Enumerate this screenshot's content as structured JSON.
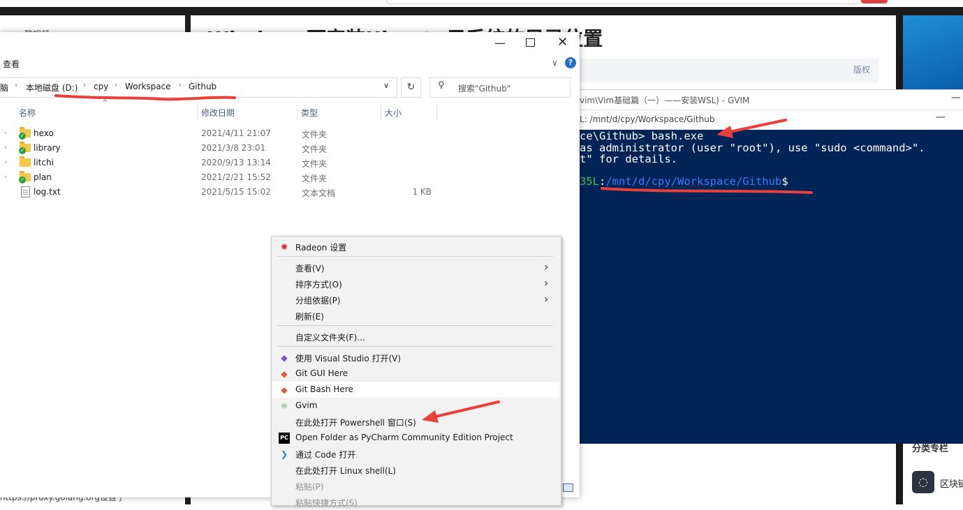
{
  "background_page": {
    "article_title": "Windows下安装Ubuntu子系统的目录位置",
    "copyright": "版权",
    "left_sidebar_text": "酷视频",
    "left_char": "疗",
    "bottom_left_text": "nttps://proxy.golang.org设置了",
    "right_panel": {
      "category": "分类专栏",
      "block_label": "区块链"
    }
  },
  "gvim": {
    "title": "vim\\Vim基础篇（一）——安装WSL) - GVIM",
    "minimize": "—"
  },
  "terminal": {
    "title": "L: /mnt/d/cpy/Workspace/Github",
    "minimize": "—",
    "line1_prefix": "ce\\Github> ",
    "line1_cmd": "bash.exe",
    "line2": "as administrator (user \"root\"), use \"sudo <command>\".",
    "line3": "t\" for details.",
    "prompt_user": "35L",
    "prompt_colon": ":",
    "prompt_path": "/mnt/d/cpy/Workspace/Github",
    "prompt_symbol": "$"
  },
  "explorer": {
    "window_controls": {
      "minimize": "—",
      "close": "✕"
    },
    "ribbon": {
      "view_tab": "查看",
      "collapse": "∨",
      "help": "?"
    },
    "breadcrumb": [
      {
        "label": "脑"
      },
      {
        "label": "本地磁盘 (D:)"
      },
      {
        "label": "cpy"
      },
      {
        "label": "Workspace"
      },
      {
        "label": "Github"
      }
    ],
    "breadcrumb_separator": "›",
    "address_dropdown": "∨",
    "refresh": "↻",
    "search": {
      "placeholder": "搜索\"Github\""
    },
    "columns": {
      "name": "名称",
      "modified": "修改日期",
      "type": "类型",
      "size": "大小"
    },
    "sort_indicator": "^",
    "files": [
      {
        "name": "hexo",
        "modified": "2021/4/11 21:07",
        "type": "文件夹",
        "size": "",
        "kind": "folder",
        "synced": true
      },
      {
        "name": "library",
        "modified": "2021/3/8 23:01",
        "type": "文件夹",
        "size": "",
        "kind": "folder",
        "synced": true
      },
      {
        "name": "litchi",
        "modified": "2020/9/13 13:14",
        "type": "文件夹",
        "size": "",
        "kind": "folder",
        "synced": false
      },
      {
        "name": "plan",
        "modified": "2021/2/21 15:52",
        "type": "文件夹",
        "size": "",
        "kind": "folder",
        "synced": true
      },
      {
        "name": "log.txt",
        "modified": "2021/5/15 15:02",
        "type": "文本文档",
        "size": "1 KB",
        "kind": "file",
        "synced": false
      }
    ]
  },
  "context_menu": {
    "items": [
      {
        "label": "Radeon 设置",
        "icon": "radeon-icon",
        "glyph": "✺"
      },
      {
        "label": "查看(V)",
        "submenu": true
      },
      {
        "label": "排序方式(O)",
        "submenu": true
      },
      {
        "label": "分组依据(P)",
        "submenu": true
      },
      {
        "label": "刷新(E)"
      },
      {
        "label": "自定义文件夹(F)..."
      },
      {
        "label": "使用 Visual Studio 打开(V)",
        "icon": "visual-studio-icon",
        "glyph": "◆"
      },
      {
        "label": "Git GUI Here",
        "icon": "git-icon",
        "glyph": "◆"
      },
      {
        "label": "Git Bash Here",
        "icon": "git-icon",
        "glyph": "◆"
      },
      {
        "label": "Gvim",
        "icon": "gvim-icon",
        "glyph": "☼"
      },
      {
        "label": "在此处打开 Powershell 窗口(S)"
      },
      {
        "label": "Open Folder as PyCharm Community Edition Project",
        "icon": "pycharm-icon",
        "glyph": "PC"
      },
      {
        "label": "通过 Code 打开",
        "icon": "vscode-icon",
        "glyph": "❯"
      },
      {
        "label": "在此处打开 Linux shell(L)"
      },
      {
        "label": "粘贴(P)",
        "disabled": true
      },
      {
        "label": "粘贴快捷方式(S)",
        "disabled": true
      }
    ],
    "submenu_arrow": "›"
  },
  "colors": {
    "terminal_bg": "#012456",
    "annotation_red": "#e8403a",
    "prompt_green": "#3ec24a",
    "prompt_blue": "#3b7bff"
  }
}
